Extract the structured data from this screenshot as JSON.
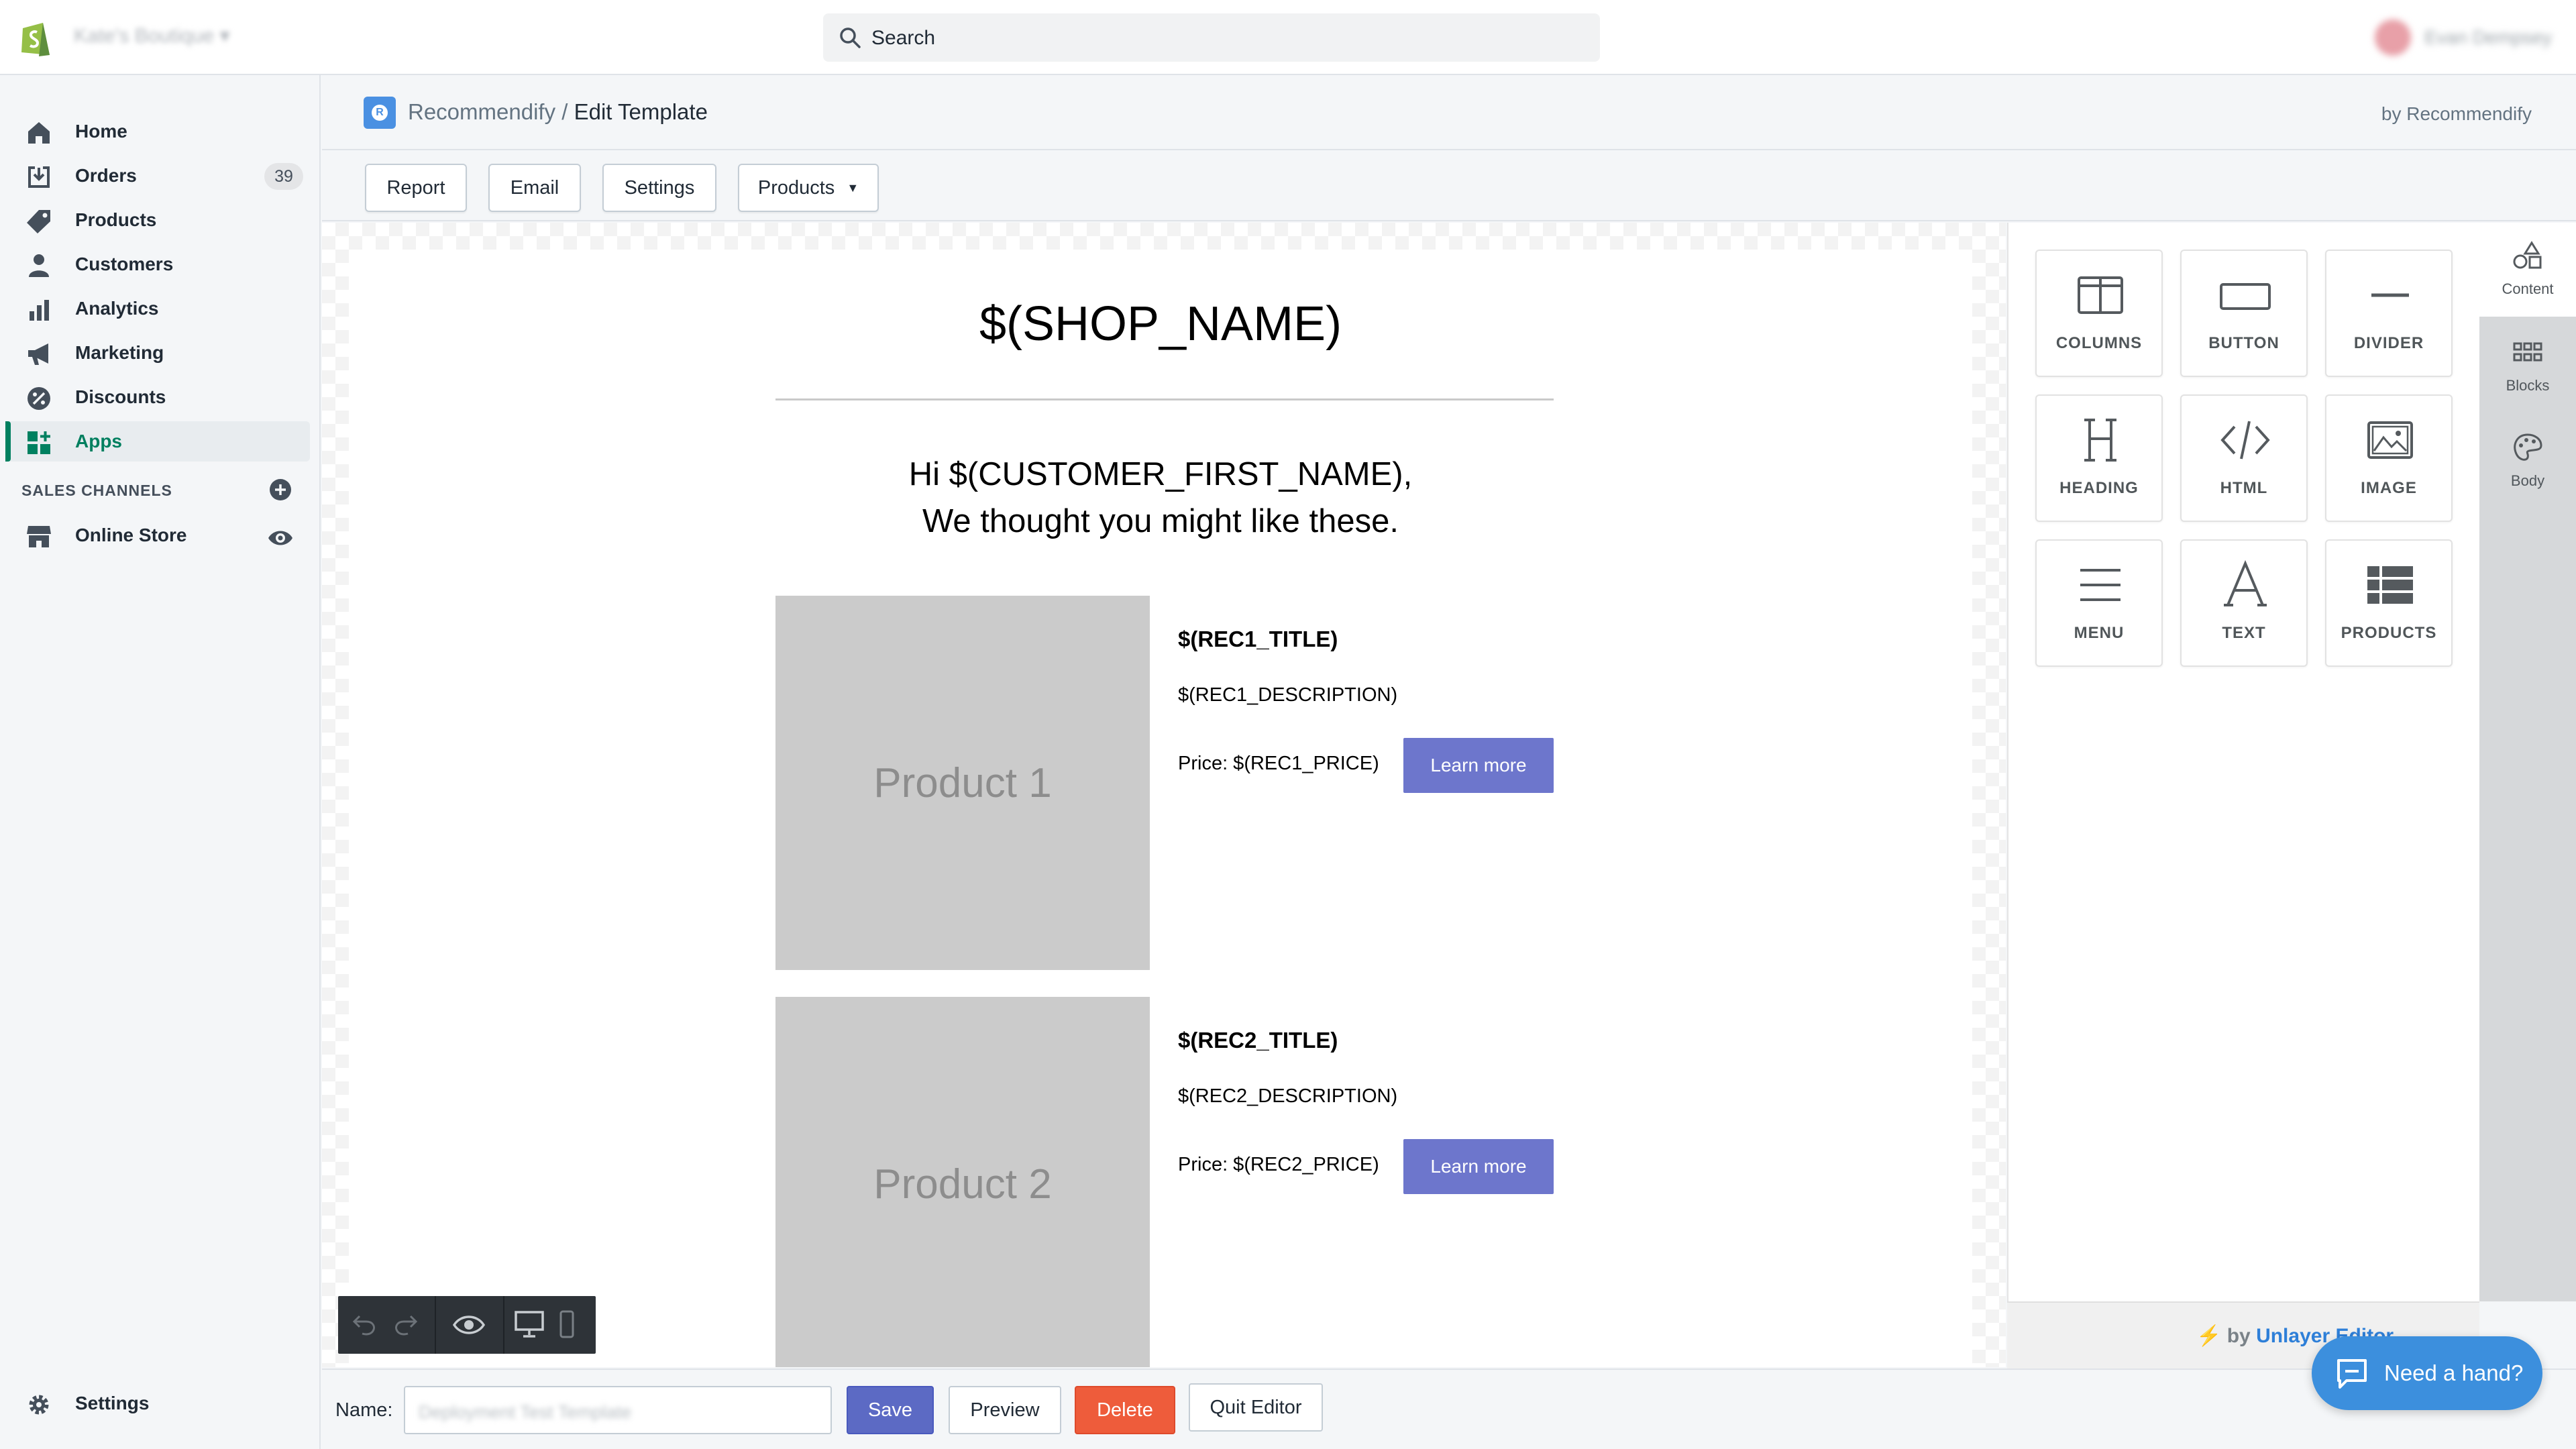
{
  "topbar": {
    "store_name": "Kate's Boutique",
    "search_placeholder": "Search",
    "user_name": "Evan Dempsey"
  },
  "sidebar": {
    "items": [
      {
        "label": "Home",
        "icon": "home-icon"
      },
      {
        "label": "Orders",
        "icon": "orders-icon",
        "badge": "39"
      },
      {
        "label": "Products",
        "icon": "tag-icon"
      },
      {
        "label": "Customers",
        "icon": "person-icon"
      },
      {
        "label": "Analytics",
        "icon": "bar-chart-icon"
      },
      {
        "label": "Marketing",
        "icon": "megaphone-icon"
      },
      {
        "label": "Discounts",
        "icon": "discount-icon"
      },
      {
        "label": "Apps",
        "icon": "apps-icon",
        "active": true
      }
    ],
    "sales_channels_label": "SALES CHANNELS",
    "online_store_label": "Online Store",
    "settings_label": "Settings"
  },
  "header": {
    "app_name": "Recommendify",
    "separator": "/",
    "page_title": "Edit Template",
    "by_label": "by Recommendify"
  },
  "toolbar": {
    "report": "Report",
    "email": "Email",
    "settings": "Settings",
    "products": "Products"
  },
  "email": {
    "shop_name": "$(SHOP_NAME)",
    "greeting_line1": "Hi $(CUSTOMER_FIRST_NAME),",
    "greeting_line2": "We thought you might like these.",
    "products": [
      {
        "image_label": "Product 1",
        "title": "$(REC1_TITLE)",
        "description": "$(REC1_DESCRIPTION)",
        "price": "Price: $(REC1_PRICE)",
        "button": "Learn more"
      },
      {
        "image_label": "Product 2",
        "title": "$(REC2_TITLE)",
        "description": "$(REC2_DESCRIPTION)",
        "price": "Price: $(REC2_PRICE)",
        "button": "Learn more"
      }
    ]
  },
  "content_tools": {
    "columns": "COLUMNS",
    "button": "BUTTON",
    "divider": "DIVIDER",
    "heading": "HEADING",
    "html": "HTML",
    "image": "IMAGE",
    "menu": "MENU",
    "text": "TEXT",
    "products": "PRODUCTS"
  },
  "right_tabs": {
    "content": "Content",
    "blocks": "Blocks",
    "body": "Body"
  },
  "unlayer": {
    "by": "by",
    "brand": "Unlayer Editor"
  },
  "footer": {
    "name_label": "Name:",
    "name_value": "Deployment Test Template",
    "save": "Save",
    "preview": "Preview",
    "delete": "Delete",
    "quit": "Quit Editor"
  },
  "chat": {
    "label": "Need a hand?"
  },
  "colors": {
    "accent_green": "#008060",
    "learn_more_button": "#6d76cc",
    "save_button": "#5c6ac4",
    "delete_button": "#ee5c3b",
    "chat_button": "#3c8fdd"
  }
}
